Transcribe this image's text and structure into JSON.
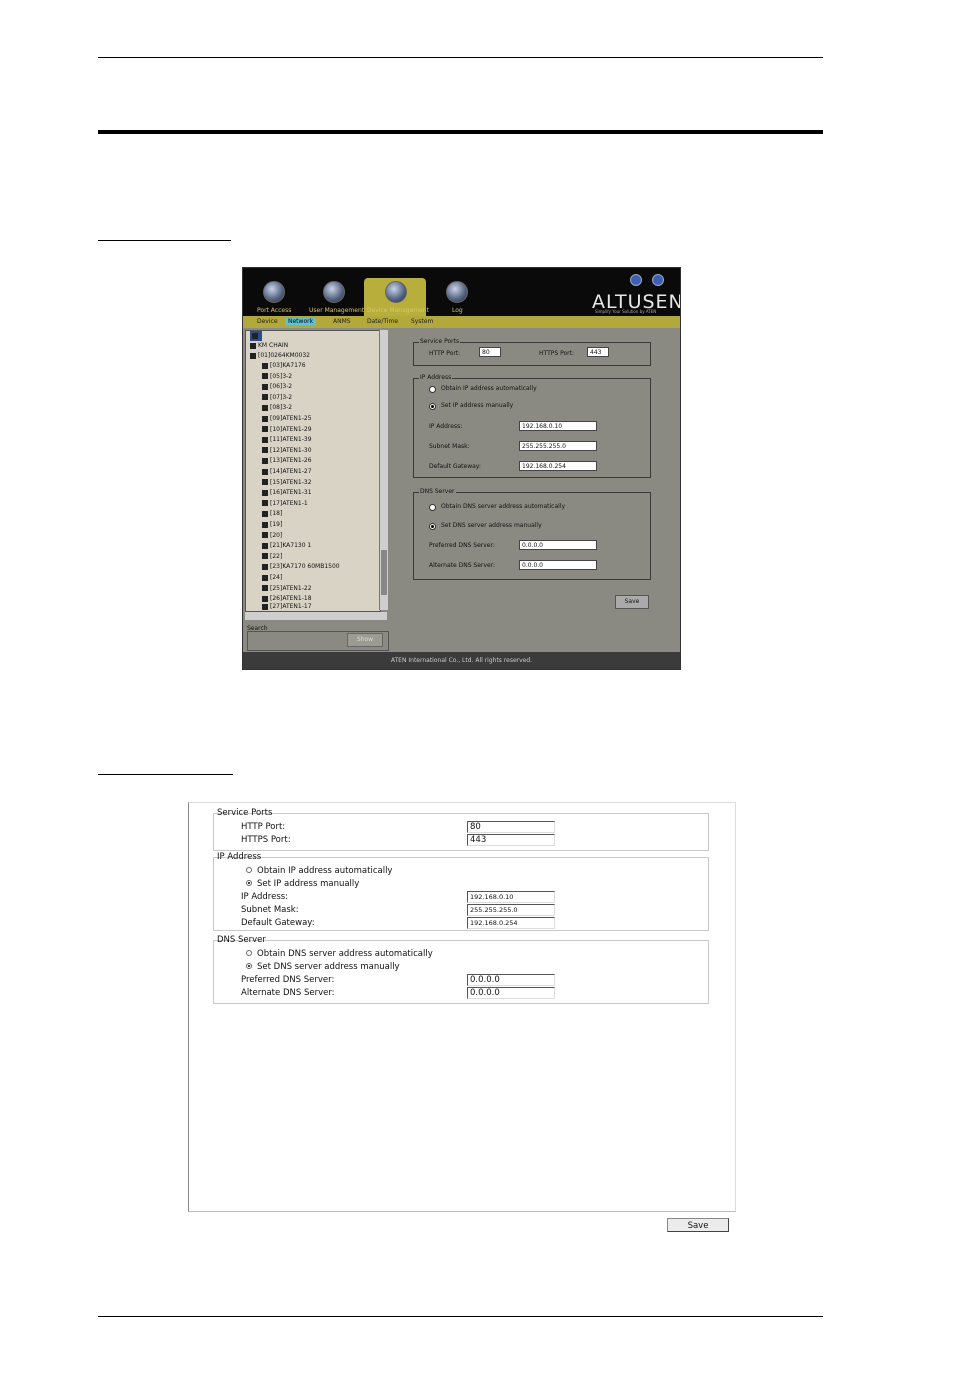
{
  "screenshot1": {
    "nav_tabs": [
      {
        "label": "Port Access"
      },
      {
        "label": "User Management"
      },
      {
        "label": "Device Management"
      },
      {
        "label": "Log"
      }
    ],
    "logo": "ALTUSEN",
    "logo_sub": "Simplify Your Solution by ATEN",
    "subtabs": [
      "Device",
      "Network",
      "ANMS",
      "Date/Time",
      "System"
    ],
    "active_subtab": "Network",
    "tree": [
      "KM CHAIN",
      "[01]0264KM0032",
      "[03]KA7176",
      "[05]3-2",
      "[06]3-2",
      "[07]3-2",
      "[08]3-2",
      "[09]ATEN1-25",
      "[10]ATEN1-29",
      "[11]ATEN1-39",
      "[12]ATEN1-30",
      "[13]ATEN1-26",
      "[14]ATEN1-27",
      "[15]ATEN1-32",
      "[16]ATEN1-31",
      "[17]ATEN1-1",
      "[18]",
      "[19]",
      "[20]",
      "[21]KA7130 1",
      "[22]",
      "[23]KA7170 60MB1500",
      "[24]",
      "[25]ATEN1-22",
      "[26]ATEN1-18",
      "[27]ATEN1-17"
    ],
    "search_label": "Search",
    "show_button": "Show",
    "service_ports": {
      "title": "Service Ports",
      "http_label": "HTTP Port:",
      "http_value": "80",
      "https_label": "HTTPS Port:",
      "https_value": "443"
    },
    "ip_address": {
      "title": "IP Address",
      "auto_label": "Obtain IP address automatically",
      "manual_label": "Set IP address manually",
      "ip_label": "IP Address:",
      "ip_value": "192.168.0.10",
      "mask_label": "Subnet Mask:",
      "mask_value": "255.255.255.0",
      "gateway_label": "Default Gateway:",
      "gateway_value": "192.168.0.254"
    },
    "dns": {
      "title": "DNS Server",
      "auto_label": "Obtain DNS server address automatically",
      "manual_label": "Set DNS server address manually",
      "preferred_label": "Preferred DNS Server:",
      "preferred_value": "0.0.0.0",
      "alternate_label": "Alternate DNS Server:",
      "alternate_value": "0.0.0.0"
    },
    "save_button": "Save",
    "footer": "ATEN International Co., Ltd. All rights reserved."
  },
  "screenshot2": {
    "service_ports": {
      "title": "Service Ports",
      "http_label": "HTTP Port:",
      "http_value": "80",
      "https_label": "HTTPS Port:",
      "https_value": "443"
    },
    "ip_address": {
      "title": "IP Address",
      "auto_label": "Obtain IP address automatically",
      "manual_label": "Set IP address manually",
      "ip_label": "IP Address:",
      "ip_value": "192.168.0.10",
      "mask_label": "Subnet Mask:",
      "mask_value": "255.255.255.0",
      "gateway_label": "Default Gateway:",
      "gateway_value": "192.168.0.254"
    },
    "dns": {
      "title": "DNS Server",
      "auto_label": "Obtain DNS server address automatically",
      "manual_label": "Set DNS server address manually",
      "preferred_label": "Preferred DNS Server:",
      "preferred_value": "0.0.0.0",
      "alternate_label": "Alternate DNS Server:",
      "alternate_value": "0.0.0.0"
    },
    "save_button": "Save"
  }
}
